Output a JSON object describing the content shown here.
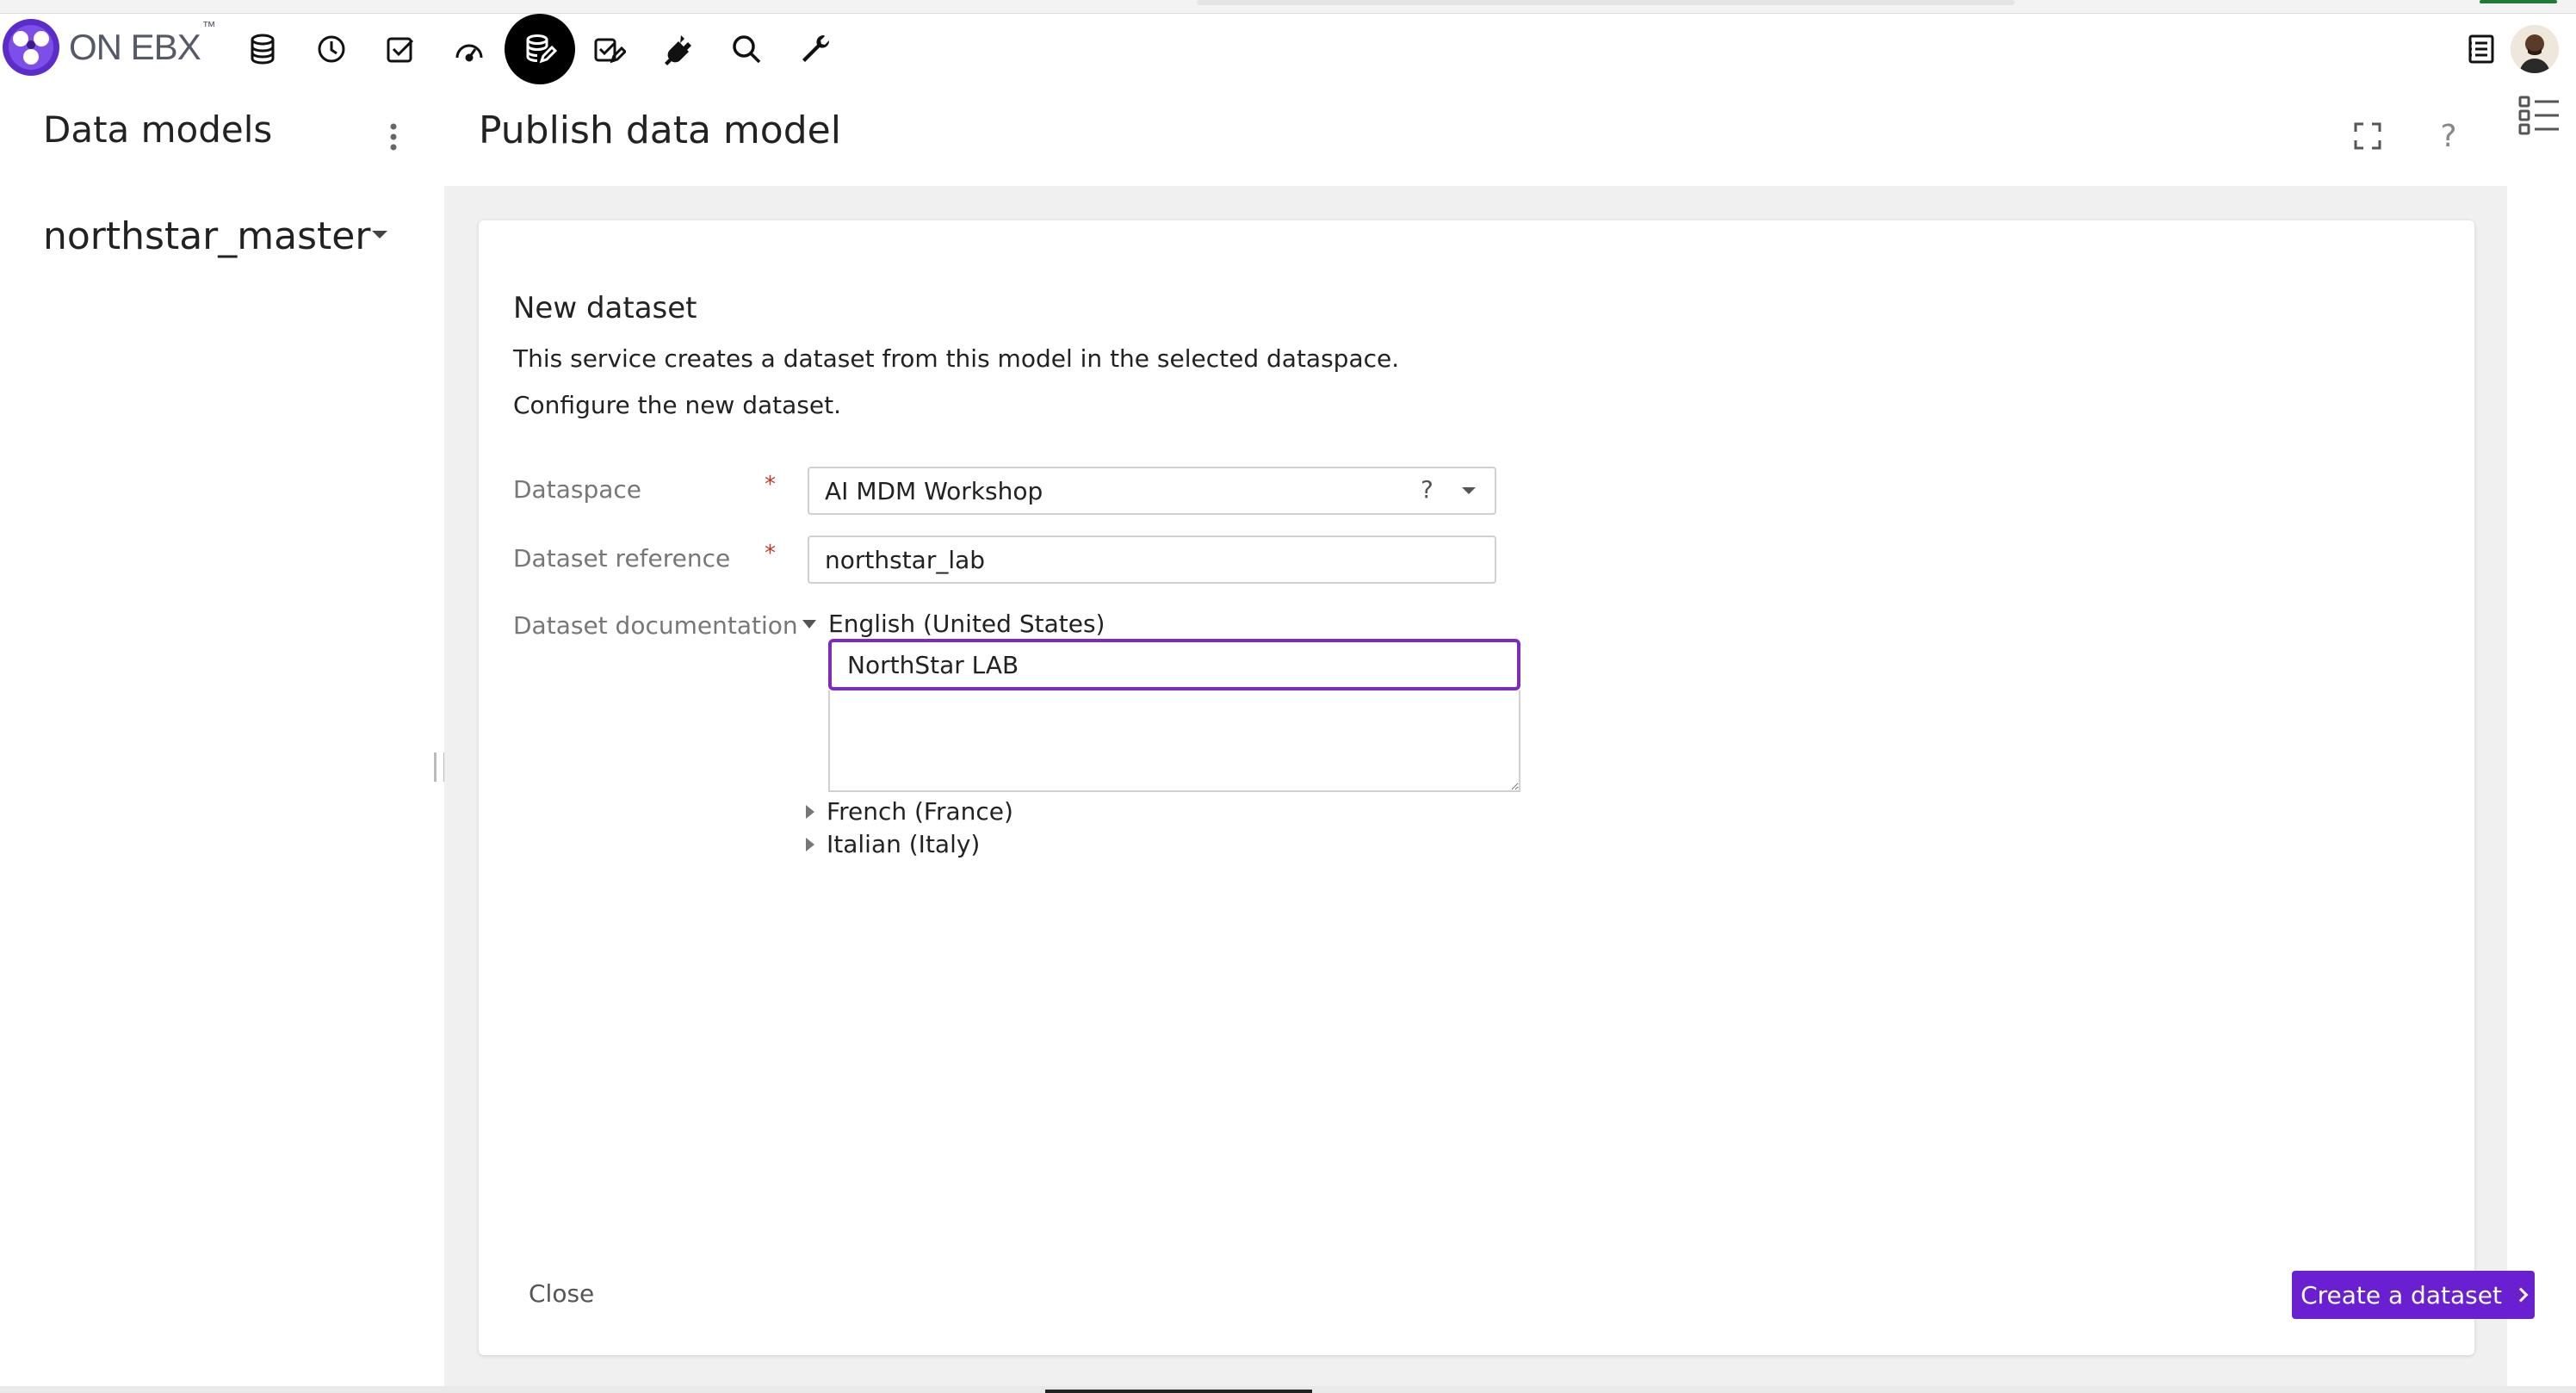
{
  "brand": {
    "name": "ON EBX",
    "tm": "™",
    "accent": "#7b2cbf",
    "button_color": "#6a1fd1"
  },
  "toolbar": {
    "tools": [
      {
        "name": "database-icon"
      },
      {
        "name": "history-icon"
      },
      {
        "name": "task-check-icon"
      },
      {
        "name": "dashboard-icon"
      },
      {
        "name": "data-model-icon",
        "active": true
      },
      {
        "name": "workflow-icon"
      },
      {
        "name": "plugin-icon"
      },
      {
        "name": "search-icon"
      },
      {
        "name": "wrench-icon"
      }
    ],
    "right_icons": [
      "task-list-icon",
      "avatar"
    ]
  },
  "sidebar": {
    "title": "Data models",
    "selected_model": "northstar_master"
  },
  "main": {
    "title": "Publish data model",
    "help": "?"
  },
  "form": {
    "section_title": "New dataset",
    "description_1": "This service creates a dataset from this model in the selected dataspace.",
    "description_2": "Configure the new dataset.",
    "required_marker": "*",
    "dataspace": {
      "label": "Dataspace",
      "value": "AI MDM Workshop",
      "help": "?"
    },
    "dataset_reference": {
      "label": "Dataset reference",
      "value": "northstar_lab"
    },
    "documentation": {
      "label": "Dataset documentation",
      "languages": [
        {
          "name": "English (United States)",
          "expanded": true,
          "label_value": "NorthStar LAB",
          "description_value": ""
        },
        {
          "name": "French (France)",
          "expanded": false
        },
        {
          "name": "Italian (Italy)",
          "expanded": false
        }
      ]
    }
  },
  "footer": {
    "close_label": "Close",
    "create_label": "Create a dataset"
  }
}
